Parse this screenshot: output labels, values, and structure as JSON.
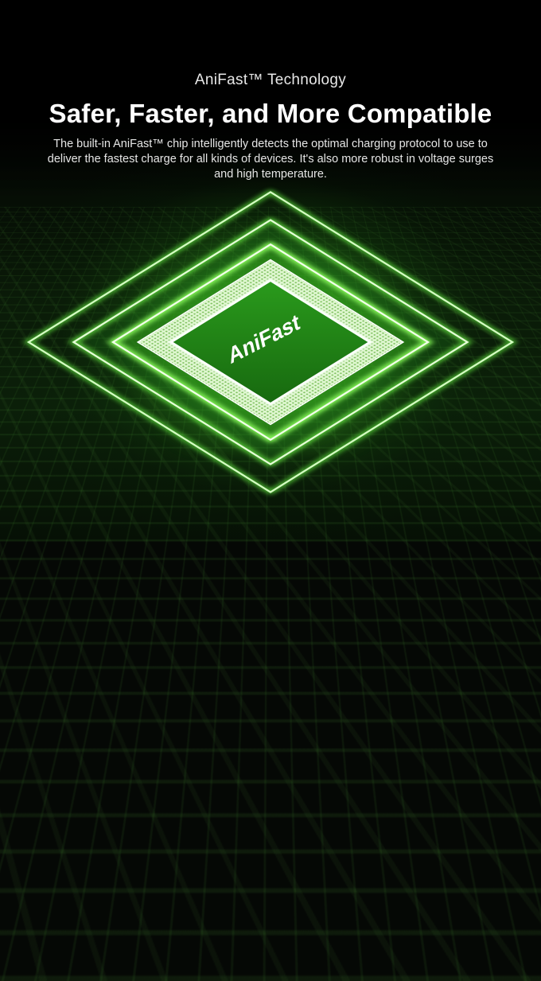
{
  "eyebrow": "AniFast™ Technology",
  "headline": "Safer, Faster, and More Compatible",
  "description": "The built-in AniFast™ chip intelligently detects the optimal charging protocol to use to deliver the fastest charge for all kinds of devices. It's also more robust in voltage surges and high temperature.",
  "chip_label": "AniFast",
  "colors": {
    "accent_green": "#3fd12a",
    "chip_face": "#1f7f14",
    "background": "#050805"
  }
}
